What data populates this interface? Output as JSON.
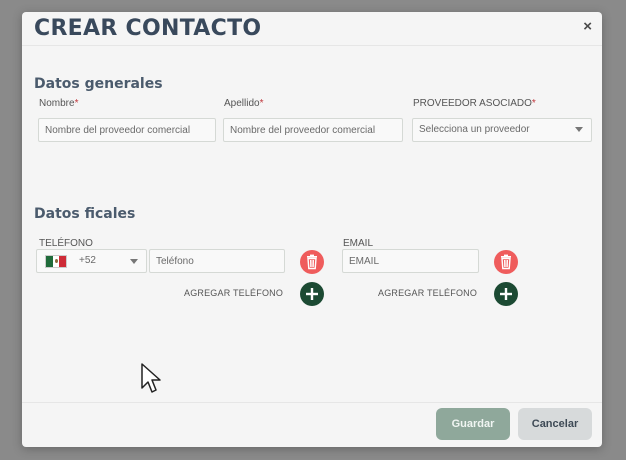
{
  "modal": {
    "title": "CREAR CONTACTO",
    "close_label": "×"
  },
  "general": {
    "section_title": "Datos generales",
    "nombre_label": "Nombre",
    "nombre_placeholder": "Nombre del proveedor comercial",
    "apellido_label": "Apellido",
    "apellido_placeholder": "Nombre del proveedor comercial",
    "proveedor_label": "PROVEEDOR ASOCIADO",
    "proveedor_value": "Selecciona un proveedor",
    "required_mark": "*"
  },
  "fiscal": {
    "section_title": "Datos ficales",
    "telefono_label": "TELÉFONO",
    "country_code": "+52",
    "country_flag": "mexico-flag-icon",
    "telefono_placeholder": "Teléfono",
    "email_label": "EMAIL",
    "email_placeholder": "EMAIL",
    "add_phone_label": "AGREGAR TELÉFONO",
    "add_email_label": "AGREGAR TELÉFONO"
  },
  "footer": {
    "save_label": "Guardar",
    "cancel_label": "Cancelar"
  },
  "colors": {
    "title": "#39495c",
    "required": "#c0353a",
    "delete": "#ef5c5c",
    "add": "#1c4a33",
    "save_button": "#8fa89b",
    "cancel_button": "#d7dadb"
  }
}
